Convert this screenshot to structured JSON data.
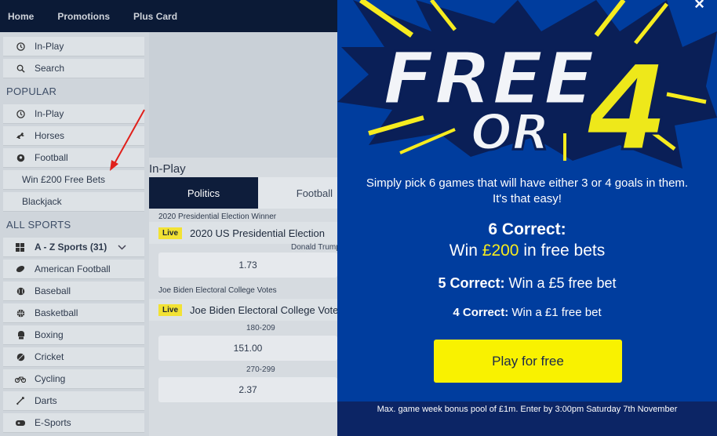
{
  "nav": {
    "items": [
      "Home",
      "Promotions",
      "Plus Card"
    ]
  },
  "sidebar": {
    "top_items": [
      {
        "label": "In-Play",
        "icon": "clock-icon"
      },
      {
        "label": "Search",
        "icon": "search-icon"
      }
    ],
    "popular_heading": "POPULAR",
    "popular_items": [
      {
        "label": "In-Play",
        "icon": "clock-icon"
      },
      {
        "label": "Horses",
        "icon": "horse-icon"
      },
      {
        "label": "Football",
        "icon": "football-icon"
      },
      {
        "label": "Win £200 Free Bets"
      },
      {
        "label": "Blackjack"
      }
    ],
    "all_sports_heading": "ALL SPORTS",
    "az_label": "A - Z Sports (31)",
    "sports": [
      {
        "label": "American Football",
        "icon": "american-football-icon"
      },
      {
        "label": "Baseball",
        "icon": "baseball-icon"
      },
      {
        "label": "Basketball",
        "icon": "basketball-icon"
      },
      {
        "label": "Boxing",
        "icon": "boxing-glove-icon"
      },
      {
        "label": "Cricket",
        "icon": "cricket-ball-icon"
      },
      {
        "label": "Cycling",
        "icon": "bicycle-icon"
      },
      {
        "label": "Darts",
        "icon": "dartboard-icon"
      },
      {
        "label": "E-Sports",
        "icon": "gamepad-icon"
      }
    ]
  },
  "inplay": {
    "title": "In-Play",
    "tabs": [
      "Politics",
      "Football"
    ],
    "markets": [
      {
        "market_title": "2020 Presidential Election Winner",
        "live": "Live",
        "event": "2020 US Presidential Election",
        "selection": "Donald Trump",
        "odds": "1.73"
      },
      {
        "market_title": "Joe Biden Electoral College Votes",
        "live": "Live",
        "event": "Joe Biden Electoral College Votes",
        "selections": [
          {
            "label": "180-209",
            "odds": "151.00"
          },
          {
            "label": "270-299",
            "odds": "2.37"
          }
        ]
      }
    ]
  },
  "popup": {
    "logo_line1": "FREE",
    "logo_line2": "OR",
    "logo_number": "4",
    "close": "×",
    "pitch": "Simply pick 6 games that will have either 3 or 4 goals in them. It's that easy!",
    "six_title": "6 Correct:",
    "six_prefix": "Win ",
    "six_amount": "£200",
    "six_suffix": " in free bets",
    "five_bold": "5 Correct:",
    "five_rest": " Win a £5 free bet",
    "four_bold": "4 Correct:",
    "four_rest": " Win a £1 free bet",
    "cta": "Play for free",
    "footer": "Max. game week bonus pool of £1m. Enter by 3:00pm Saturday 7th November"
  },
  "colors": {
    "nav_bg": "#0b1a36",
    "popup_bg": "#003d9e",
    "accent_yellow": "#f9f200",
    "live_badge": "#f2e234",
    "annotation_red": "#e0201b"
  }
}
